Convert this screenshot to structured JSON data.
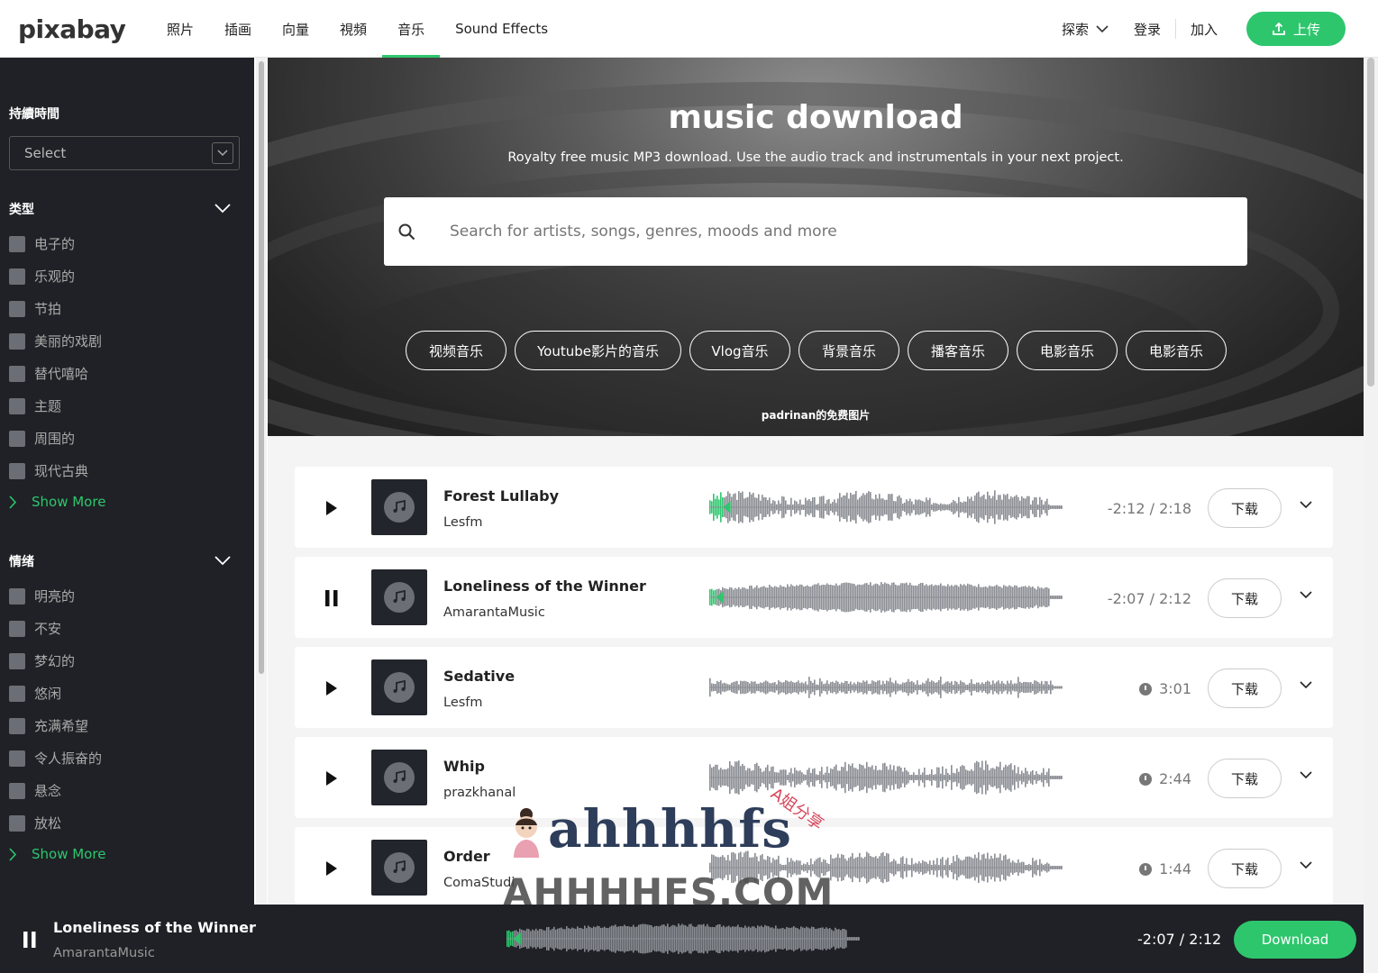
{
  "header": {
    "logo": "pixabay",
    "nav": [
      "照片",
      "插画",
      "向量",
      "視頻",
      "音乐",
      "Sound Effects"
    ],
    "active_nav": "音乐",
    "explore": "探索",
    "login": "登录",
    "join": "加入",
    "upload": "上传",
    "accent": "#2ec66d"
  },
  "sidebar": {
    "duration_title": "持續時間",
    "select_placeholder": "Select",
    "genre_title": "类型",
    "genres": [
      "电子的",
      "乐观的",
      "节拍",
      "美丽的戏剧",
      "替代嘻哈",
      "主题",
      "周围的",
      "现代古典"
    ],
    "mood_title": "情绪",
    "moods": [
      "明亮的",
      "不安",
      "梦幻的",
      "悠闲",
      "充满希望",
      "令人振奋的",
      "悬念",
      "放松"
    ],
    "show_more": "Show More"
  },
  "hero": {
    "title": "music download",
    "subtitle": "Royalty free music MP3 download. Use the audio track and instrumentals in your next project.",
    "search_placeholder": "Search for artists, songs, genres, moods and more",
    "chips": [
      "视频音乐",
      "Youtube影片的音乐",
      "Vlog音乐",
      "背景音乐",
      "播客音乐",
      "电影音乐",
      "电影音乐"
    ],
    "credit": "padrinan的免费图片"
  },
  "tracks": [
    {
      "title": "Forest Lullaby",
      "artist": "Lesfm",
      "time": "-2:12 / 2:18",
      "state": "play",
      "download": "下载"
    },
    {
      "title": "Loneliness of the Winner",
      "artist": "AmarantaMusic",
      "time": "-2:07 / 2:12",
      "state": "pause",
      "download": "下载"
    },
    {
      "title": "Sedative",
      "artist": "Lesfm",
      "time": "3:01",
      "state": "play",
      "download": "下载"
    },
    {
      "title": "Whip",
      "artist": "prazkhanal",
      "time": "2:44",
      "state": "play",
      "download": "下载"
    },
    {
      "title": "Order",
      "artist": "ComaStudi",
      "time": "1:44",
      "state": "play",
      "download": "下载"
    }
  ],
  "player": {
    "title": "Loneliness of the Winner",
    "artist": "AmarantaMusic",
    "time": "-2:07 / 2:12",
    "download": "Download"
  },
  "watermark": {
    "top": "ahhhhfs",
    "bottom": "AHHHHFS.COM",
    "side": "A姐分享"
  }
}
